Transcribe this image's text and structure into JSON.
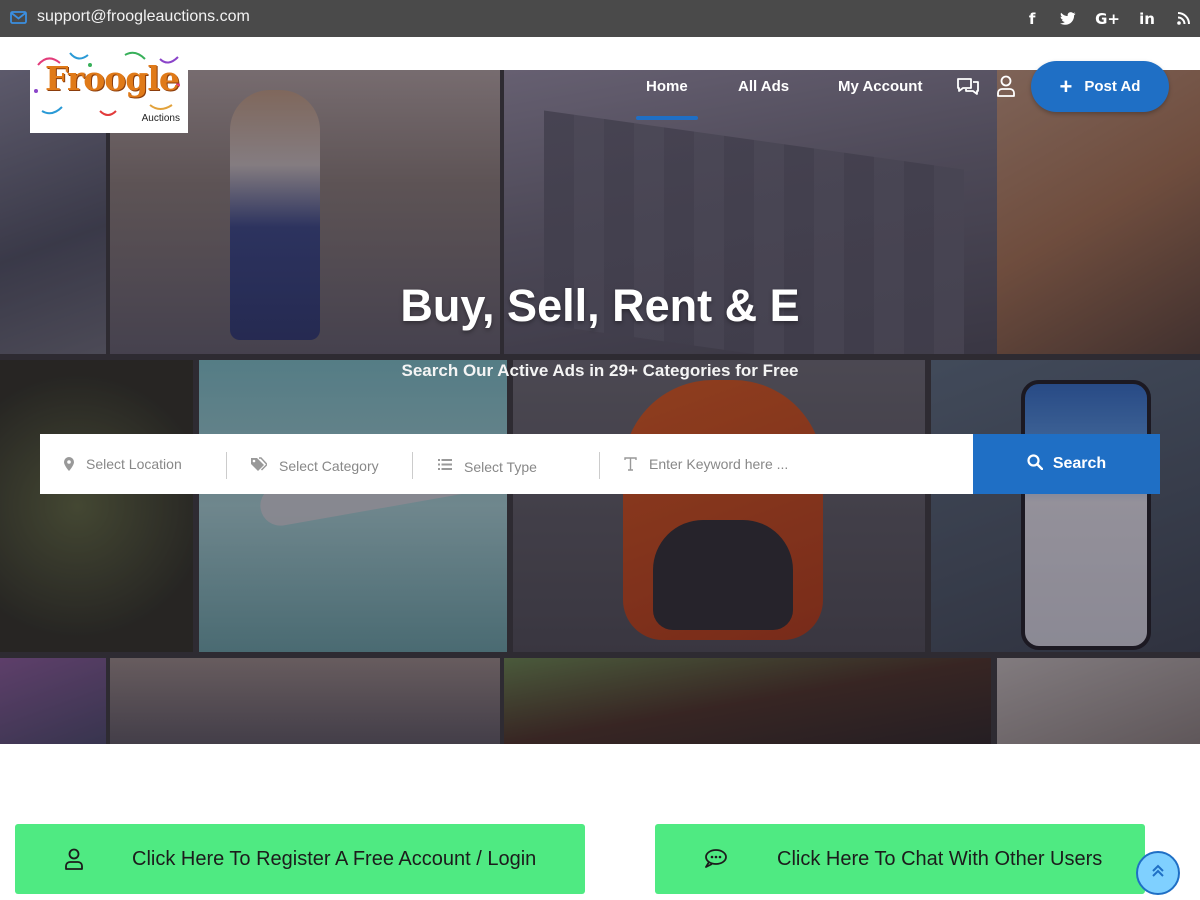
{
  "topbar": {
    "email": "support@froogleauctions.com",
    "social_icons": [
      "facebook-icon",
      "twitter-icon",
      "google-plus-icon",
      "linkedin-icon",
      "rss-icon"
    ],
    "social_glyphs": {
      "facebook": "f",
      "twitter": "t",
      "google_plus": "G+",
      "linkedin": "in",
      "rss": "rss"
    }
  },
  "logo": {
    "name": "Froogle",
    "tagline": "Auctions"
  },
  "nav": {
    "items": [
      {
        "label": "Home",
        "active": true
      },
      {
        "label": "All Ads",
        "active": false
      },
      {
        "label": "My Account",
        "active": false
      }
    ],
    "icons": [
      "chat-icon",
      "user-icon"
    ],
    "post_ad": "Post Ad"
  },
  "hero": {
    "title": "Buy, Sell, Rent & E",
    "subtitle": "Search Our Active Ads in 29+ Categories for Free"
  },
  "search": {
    "location_placeholder": "Select Location",
    "category_placeholder": "Select Category",
    "type_placeholder": "Select Type",
    "keyword_placeholder": "Enter Keyword here ...",
    "button_label": "Search"
  },
  "cta": {
    "register": "Click Here To Register A Free Account / Login",
    "chat": "Click Here To Chat With Other Users"
  },
  "colors": {
    "accent": "#1f6fc5",
    "cta_green": "#4fea82",
    "topbar": "#4a4a4a"
  }
}
